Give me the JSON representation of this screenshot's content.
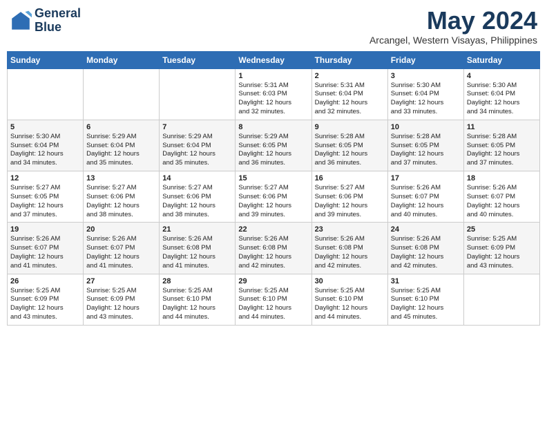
{
  "logo": {
    "line1": "General",
    "line2": "Blue"
  },
  "title": "May 2024",
  "location": "Arcangel, Western Visayas, Philippines",
  "days_header": [
    "Sunday",
    "Monday",
    "Tuesday",
    "Wednesday",
    "Thursday",
    "Friday",
    "Saturday"
  ],
  "weeks": [
    [
      {
        "day": "",
        "content": ""
      },
      {
        "day": "",
        "content": ""
      },
      {
        "day": "",
        "content": ""
      },
      {
        "day": "1",
        "content": "Sunrise: 5:31 AM\nSunset: 6:03 PM\nDaylight: 12 hours\nand 32 minutes."
      },
      {
        "day": "2",
        "content": "Sunrise: 5:31 AM\nSunset: 6:04 PM\nDaylight: 12 hours\nand 32 minutes."
      },
      {
        "day": "3",
        "content": "Sunrise: 5:30 AM\nSunset: 6:04 PM\nDaylight: 12 hours\nand 33 minutes."
      },
      {
        "day": "4",
        "content": "Sunrise: 5:30 AM\nSunset: 6:04 PM\nDaylight: 12 hours\nand 34 minutes."
      }
    ],
    [
      {
        "day": "5",
        "content": "Sunrise: 5:30 AM\nSunset: 6:04 PM\nDaylight: 12 hours\nand 34 minutes."
      },
      {
        "day": "6",
        "content": "Sunrise: 5:29 AM\nSunset: 6:04 PM\nDaylight: 12 hours\nand 35 minutes."
      },
      {
        "day": "7",
        "content": "Sunrise: 5:29 AM\nSunset: 6:04 PM\nDaylight: 12 hours\nand 35 minutes."
      },
      {
        "day": "8",
        "content": "Sunrise: 5:29 AM\nSunset: 6:05 PM\nDaylight: 12 hours\nand 36 minutes."
      },
      {
        "day": "9",
        "content": "Sunrise: 5:28 AM\nSunset: 6:05 PM\nDaylight: 12 hours\nand 36 minutes."
      },
      {
        "day": "10",
        "content": "Sunrise: 5:28 AM\nSunset: 6:05 PM\nDaylight: 12 hours\nand 37 minutes."
      },
      {
        "day": "11",
        "content": "Sunrise: 5:28 AM\nSunset: 6:05 PM\nDaylight: 12 hours\nand 37 minutes."
      }
    ],
    [
      {
        "day": "12",
        "content": "Sunrise: 5:27 AM\nSunset: 6:05 PM\nDaylight: 12 hours\nand 37 minutes."
      },
      {
        "day": "13",
        "content": "Sunrise: 5:27 AM\nSunset: 6:06 PM\nDaylight: 12 hours\nand 38 minutes."
      },
      {
        "day": "14",
        "content": "Sunrise: 5:27 AM\nSunset: 6:06 PM\nDaylight: 12 hours\nand 38 minutes."
      },
      {
        "day": "15",
        "content": "Sunrise: 5:27 AM\nSunset: 6:06 PM\nDaylight: 12 hours\nand 39 minutes."
      },
      {
        "day": "16",
        "content": "Sunrise: 5:27 AM\nSunset: 6:06 PM\nDaylight: 12 hours\nand 39 minutes."
      },
      {
        "day": "17",
        "content": "Sunrise: 5:26 AM\nSunset: 6:07 PM\nDaylight: 12 hours\nand 40 minutes."
      },
      {
        "day": "18",
        "content": "Sunrise: 5:26 AM\nSunset: 6:07 PM\nDaylight: 12 hours\nand 40 minutes."
      }
    ],
    [
      {
        "day": "19",
        "content": "Sunrise: 5:26 AM\nSunset: 6:07 PM\nDaylight: 12 hours\nand 41 minutes."
      },
      {
        "day": "20",
        "content": "Sunrise: 5:26 AM\nSunset: 6:07 PM\nDaylight: 12 hours\nand 41 minutes."
      },
      {
        "day": "21",
        "content": "Sunrise: 5:26 AM\nSunset: 6:08 PM\nDaylight: 12 hours\nand 41 minutes."
      },
      {
        "day": "22",
        "content": "Sunrise: 5:26 AM\nSunset: 6:08 PM\nDaylight: 12 hours\nand 42 minutes."
      },
      {
        "day": "23",
        "content": "Sunrise: 5:26 AM\nSunset: 6:08 PM\nDaylight: 12 hours\nand 42 minutes."
      },
      {
        "day": "24",
        "content": "Sunrise: 5:26 AM\nSunset: 6:08 PM\nDaylight: 12 hours\nand 42 minutes."
      },
      {
        "day": "25",
        "content": "Sunrise: 5:25 AM\nSunset: 6:09 PM\nDaylight: 12 hours\nand 43 minutes."
      }
    ],
    [
      {
        "day": "26",
        "content": "Sunrise: 5:25 AM\nSunset: 6:09 PM\nDaylight: 12 hours\nand 43 minutes."
      },
      {
        "day": "27",
        "content": "Sunrise: 5:25 AM\nSunset: 6:09 PM\nDaylight: 12 hours\nand 43 minutes."
      },
      {
        "day": "28",
        "content": "Sunrise: 5:25 AM\nSunset: 6:10 PM\nDaylight: 12 hours\nand 44 minutes."
      },
      {
        "day": "29",
        "content": "Sunrise: 5:25 AM\nSunset: 6:10 PM\nDaylight: 12 hours\nand 44 minutes."
      },
      {
        "day": "30",
        "content": "Sunrise: 5:25 AM\nSunset: 6:10 PM\nDaylight: 12 hours\nand 44 minutes."
      },
      {
        "day": "31",
        "content": "Sunrise: 5:25 AM\nSunset: 6:10 PM\nDaylight: 12 hours\nand 45 minutes."
      },
      {
        "day": "",
        "content": ""
      }
    ]
  ]
}
